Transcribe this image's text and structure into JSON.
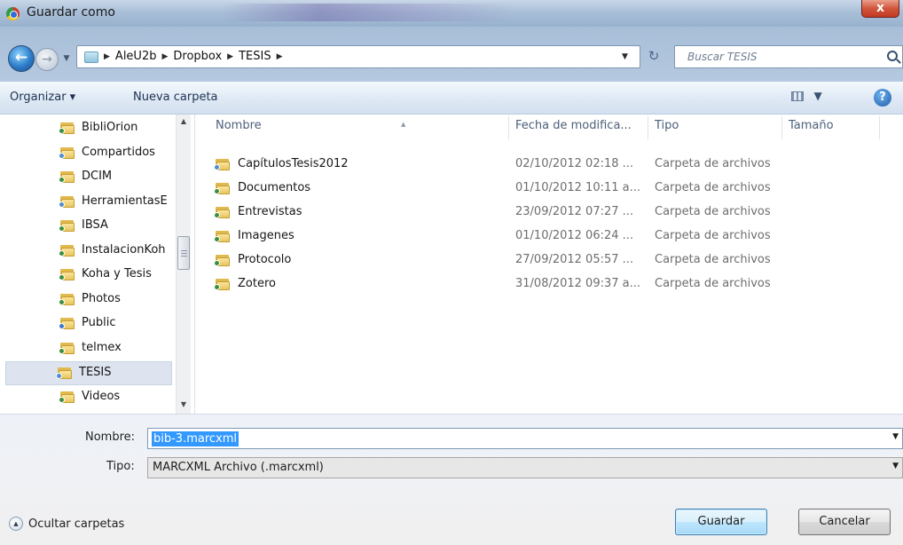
{
  "window": {
    "title": "Guardar como",
    "close_glyph": "x"
  },
  "address": {
    "crumbs": [
      "AleU2b",
      "Dropbox",
      "TESIS"
    ],
    "search_placeholder": "Buscar TESIS"
  },
  "toolbar": {
    "organize_label": "Organizar ▾",
    "new_folder_label": "Nueva carpeta",
    "help_glyph": "?"
  },
  "nav": {
    "items": [
      {
        "label": "BibliOrion",
        "badge": "green"
      },
      {
        "label": "Compartidos",
        "badge": "people"
      },
      {
        "label": "DCIM",
        "badge": "green"
      },
      {
        "label": "HerramientasE",
        "badge": "people"
      },
      {
        "label": "IBSA",
        "badge": "green"
      },
      {
        "label": "InstalacionKoh",
        "badge": "green"
      },
      {
        "label": "Koha y Tesis",
        "badge": "green"
      },
      {
        "label": "Photos",
        "badge": "green"
      },
      {
        "label": "Public",
        "badge": "blue"
      },
      {
        "label": "telmex",
        "badge": "green"
      },
      {
        "label": "TESIS",
        "badge": "people",
        "selected": true
      },
      {
        "label": "Videos",
        "badge": "green"
      }
    ]
  },
  "columns": {
    "name": "Nombre",
    "date": "Fecha de modifica...",
    "type": "Tipo",
    "size": "Tamaño"
  },
  "files": [
    {
      "name": "CapítulosTesis2012",
      "date": "02/10/2012 02:18 ...",
      "type": "Carpeta de archivos",
      "badge": "people"
    },
    {
      "name": "Documentos",
      "date": "01/10/2012 10:11 a...",
      "type": "Carpeta de archivos",
      "badge": "green"
    },
    {
      "name": "Entrevistas",
      "date": "23/09/2012 07:27 ...",
      "type": "Carpeta de archivos",
      "badge": "green"
    },
    {
      "name": "Imagenes",
      "date": "01/10/2012 06:24 ...",
      "type": "Carpeta de archivos",
      "badge": "green"
    },
    {
      "name": "Protocolo",
      "date": "27/09/2012 05:57 ...",
      "type": "Carpeta de archivos",
      "badge": "green"
    },
    {
      "name": "Zotero",
      "date": "31/08/2012 09:37 a...",
      "type": "Carpeta de archivos",
      "badge": "green"
    }
  ],
  "form": {
    "name_label": "Nombre:",
    "name_value": "bib-3.marcxml",
    "type_label": "Tipo:",
    "type_value": "MARCXML Archivo (.marcxml)"
  },
  "footer": {
    "hide_folders_label": "Ocultar carpetas",
    "save_label": "Guardar",
    "cancel_label": "Cancelar"
  },
  "icons": {
    "app": "chrome-icon",
    "back": "back-arrow-icon",
    "forward": "forward-arrow-icon",
    "refresh": "refresh-icon",
    "search": "search-icon",
    "folder": "folder-icon",
    "help": "help-icon"
  }
}
